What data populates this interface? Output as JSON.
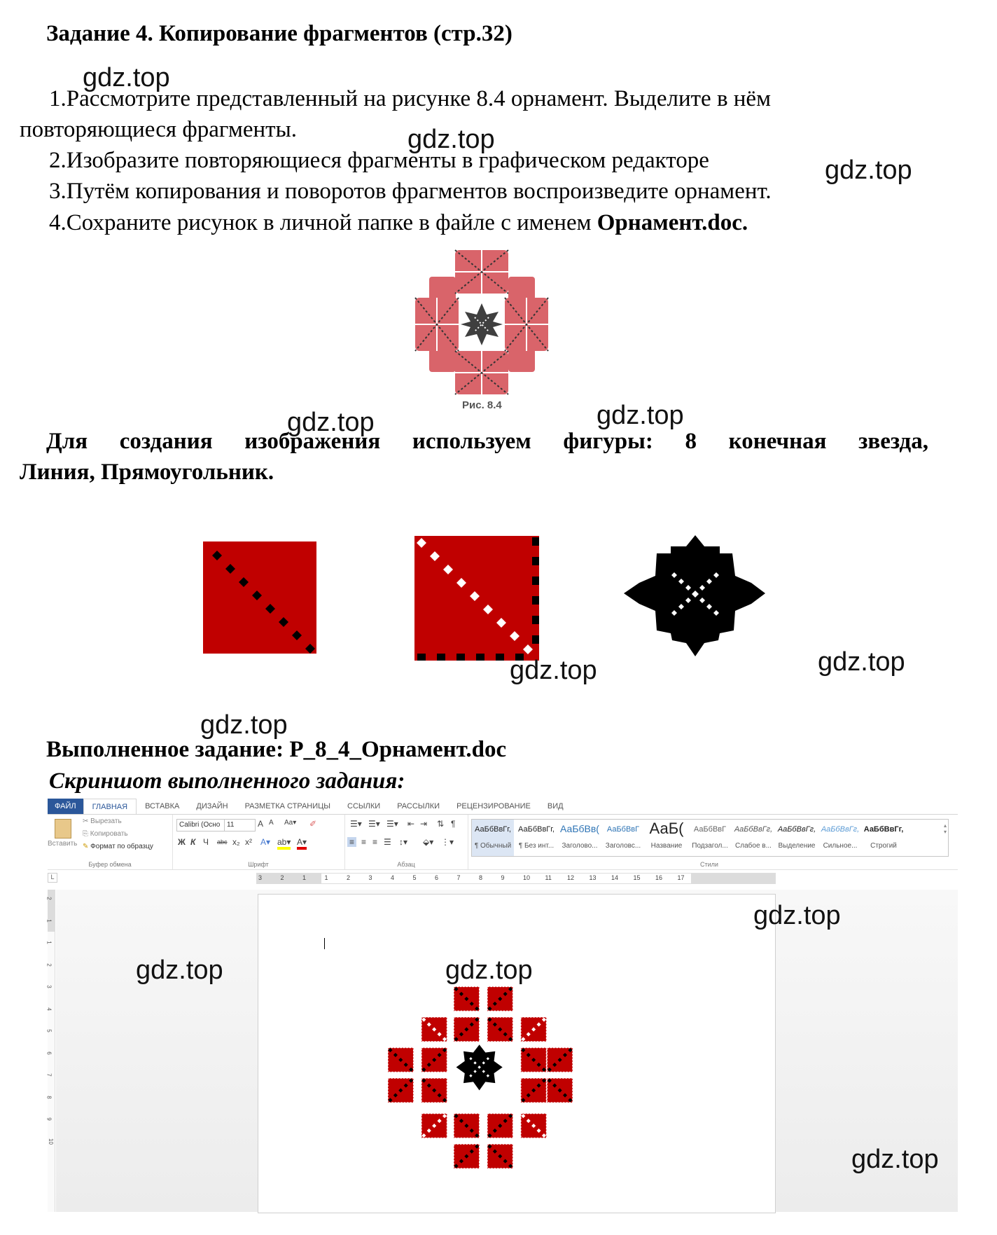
{
  "task": {
    "title": "Задание 4. Копирование фрагментов (стр.32)",
    "steps": [
      "1.Рассмотрите представленный на рисунке 8.4 орнамент. Выделите в нём",
      "повторяющиеся фрагменты.",
      "2.Изобразите повторяющиеся фрагменты в графическом редакторе",
      "3.Путём копирования и поворотов фрагментов воспроизведите орнамент.",
      "4.Сохраните рисунок в личной папке в файле с именем "
    ],
    "filename_bold": "Орнамент.doc.",
    "figure_caption": "Рис. 8.4"
  },
  "shapes_note": {
    "line1": "Для создания изображения используем фигуры: 8 конечная звезда,",
    "line2": "Линия, Прямоугольник."
  },
  "shapes": [
    {
      "name": "red-square-black-diagonal",
      "fill": "#c00000",
      "dots": "#000000"
    },
    {
      "name": "red-square-white-diagonal",
      "fill": "#c00000",
      "dots": "#ffffff"
    },
    {
      "name": "black-8-point-star",
      "fill": "#000000",
      "dots": "#ffffff"
    }
  ],
  "result": {
    "label": "Выполненное задание: Р_8_4_Орнамент.doc",
    "screenshot_label": "Скриншот выполненного задания:"
  },
  "watermark": "gdz.top",
  "word": {
    "tabs": [
      "ФАЙЛ",
      "ГЛАВНАЯ",
      "ВСТАВКА",
      "ДИЗАЙН",
      "РАЗМЕТКА СТРАНИЦЫ",
      "ССЫЛКИ",
      "РАССЫЛКИ",
      "РЕЦЕНЗИРОВАНИЕ",
      "ВИД"
    ],
    "clipboard": {
      "paste": "Вставить",
      "cut": "Вырезать",
      "copy": "Копировать",
      "format_painter": "Формат по образцу",
      "group": "Буфер обмена"
    },
    "font": {
      "name": "Calibri (Осно",
      "size": "11",
      "bold": "Ж",
      "italic": "К",
      "underline": "Ч",
      "strike": "abc",
      "sub": "x₂",
      "sup": "x²",
      "group": "Шрифт"
    },
    "paragraph": {
      "group": "Абзац"
    },
    "styles": {
      "group": "Стили",
      "items": [
        {
          "preview": "АаБбВвГг,",
          "name": "¶ Обычный"
        },
        {
          "preview": "АаБбВвГг,",
          "name": "¶ Без инт..."
        },
        {
          "preview": "АаБбВв(",
          "name": "Заголово..."
        },
        {
          "preview": "АаБбВвГ",
          "name": "Заголовс..."
        },
        {
          "preview": "АаБ(",
          "name": "Название"
        },
        {
          "preview": "АаБбВвГ",
          "name": "Подзагол..."
        },
        {
          "preview": "АаБбВвГг,",
          "name": "Слабое в..."
        },
        {
          "preview": "АаБбВвГг,",
          "name": "Выделение"
        },
        {
          "preview": "АаБбВвГг,",
          "name": "Сильное..."
        },
        {
          "preview": "АаБбВвГг,",
          "name": "Строгий"
        }
      ]
    },
    "ruler_h": [
      "3",
      "2",
      "1",
      "1",
      "2",
      "3",
      "4",
      "5",
      "6",
      "7",
      "8",
      "9",
      "10",
      "11",
      "12",
      "13",
      "14",
      "15",
      "16",
      "17"
    ],
    "ruler_v": [
      "2",
      "1",
      "1",
      "2",
      "3",
      "4",
      "5",
      "6",
      "7",
      "8",
      "9",
      "10"
    ],
    "colors": {
      "file_tab": "#2b579a",
      "highlight": "#ffff00",
      "font_color": "#e00000"
    }
  }
}
